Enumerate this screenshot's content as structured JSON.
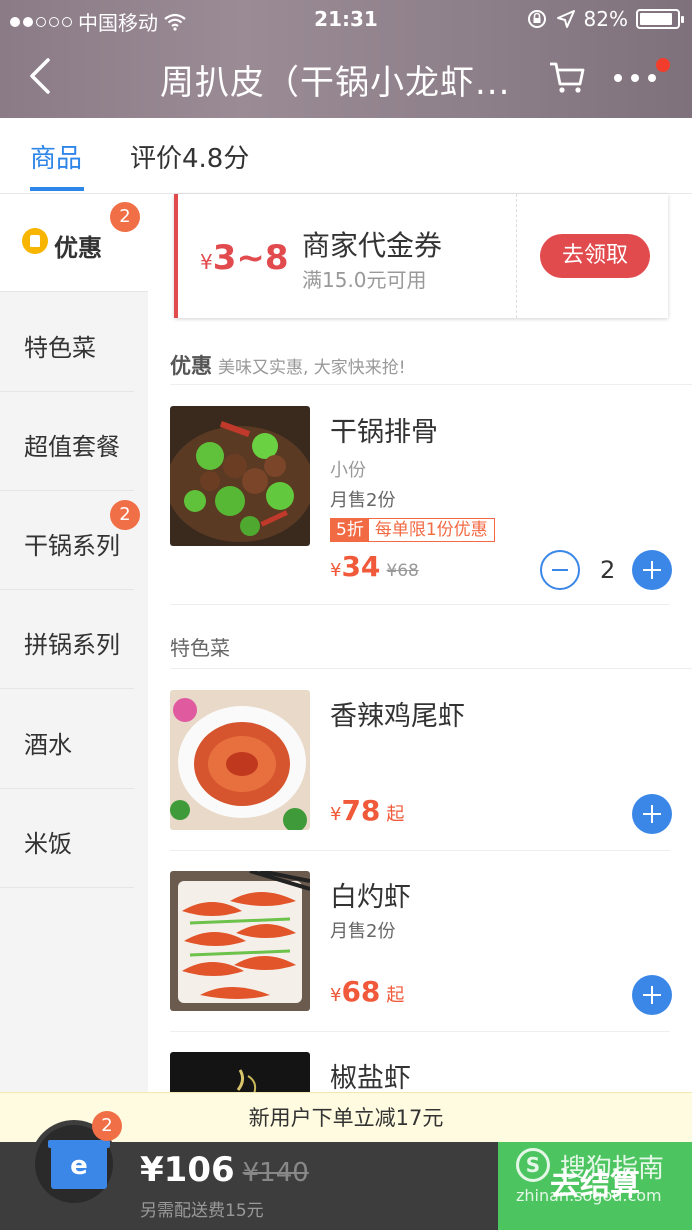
{
  "status_bar": {
    "carrier": "中国移动",
    "time": "21:31",
    "battery": "82%"
  },
  "header": {
    "title": "周扒皮（干锅小龙虾..."
  },
  "tabs": [
    {
      "label": "商品",
      "active": true
    },
    {
      "label": "评价4.8分",
      "active": false
    }
  ],
  "sidebar": {
    "items": [
      {
        "label": "优惠",
        "badge": "2",
        "active": true
      },
      {
        "label": "特色菜"
      },
      {
        "label": "超值套餐"
      },
      {
        "label": "干锅系列",
        "badge": "2"
      },
      {
        "label": "拼锅系列"
      },
      {
        "label": "酒水"
      },
      {
        "label": "米饭"
      }
    ]
  },
  "coupon": {
    "currency": "¥",
    "amount": "3~8",
    "name": "商家代金券",
    "condition": "满15.0元可用",
    "button": "去领取"
  },
  "sections": [
    {
      "title": "优惠",
      "subtitle": "美味又实惠, 大家快来抢!"
    },
    {
      "title": "特色菜"
    }
  ],
  "dishes": [
    {
      "name": "干锅排骨",
      "spec": "小份",
      "sold": "月售2份",
      "discount_tag": "5折",
      "limit_tag": "每单限1份优惠",
      "currency": "¥",
      "price": "34",
      "old_price": "¥68",
      "quantity": "2"
    },
    {
      "name": "香辣鸡尾虾",
      "currency": "¥",
      "price": "78",
      "suffix": "起"
    },
    {
      "name": "白灼虾",
      "sold": "月售2份",
      "currency": "¥",
      "price": "68",
      "suffix": "起"
    },
    {
      "name": "椒盐虾"
    }
  ],
  "promo_text": "新用户下单立减17元",
  "cart": {
    "badge": "2",
    "total": "¥106",
    "old_total": "¥140",
    "delivery_note": "另需配送费15元",
    "checkout": "去结算"
  },
  "watermark": {
    "logo": "S",
    "text": "搜狗指南",
    "url": "zhinan.sogou.com"
  },
  "icons": [
    "back-icon",
    "cart-icon",
    "more-icon",
    "coupon-icon",
    "plus-icon",
    "minus-icon",
    "shopping-box-icon",
    "wifi-icon",
    "location-icon"
  ],
  "colors": {
    "accent": "#2f86e9",
    "price": "#f05a3a",
    "coupon_red": "#e24b4e",
    "checkout_green": "#4cc560",
    "badge": "#f06f46"
  }
}
